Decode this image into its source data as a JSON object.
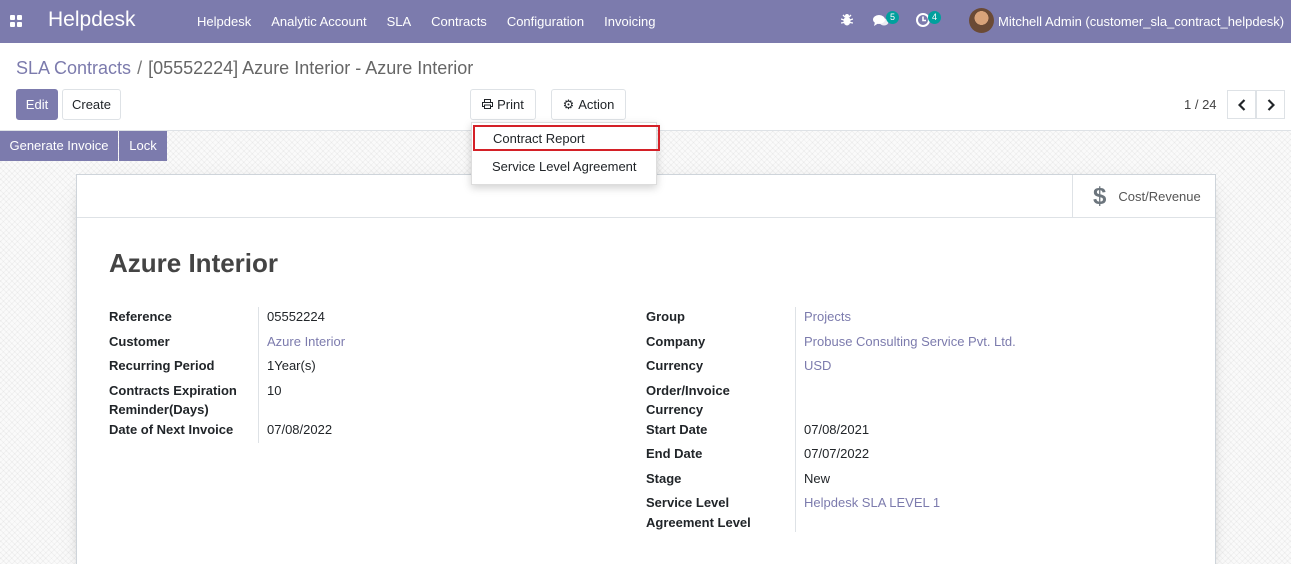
{
  "navbar": {
    "brand": "Helpdesk",
    "menu": [
      "Helpdesk",
      "Analytic Account",
      "SLA",
      "Contracts",
      "Configuration",
      "Invoicing"
    ],
    "messages_count": "5",
    "activities_count": "4",
    "user": "Mitchell Admin (customer_sla_contract_helpdesk)"
  },
  "breadcrumb": {
    "parent": "SLA Contracts",
    "separator": "/",
    "current": "[05552224] Azure Interior - Azure Interior"
  },
  "buttons": {
    "edit": "Edit",
    "create": "Create",
    "print": "Print",
    "action": "Action",
    "generate_invoice": "Generate Invoice",
    "lock": "Lock"
  },
  "pager": {
    "value": "1 / 24"
  },
  "print_menu": [
    "Contract Report",
    "Service Level Agreement"
  ],
  "stat_button": {
    "label": "Cost/Revenue",
    "icon": "dollar-icon"
  },
  "record": {
    "title": "Azure Interior",
    "left": {
      "reference_label": "Reference",
      "reference": "05552224",
      "customer_label": "Customer",
      "customer": "Azure Interior",
      "recurring_label": "Recurring Period",
      "recurring": "1Year(s)",
      "expiration_label_1": "Contracts Expiration",
      "expiration_label_2": "Reminder(Days)",
      "expiration": "10",
      "next_invoice_label": "Date of Next Invoice",
      "next_invoice": "07/08/2022"
    },
    "right": {
      "group_label": "Group",
      "group": "Projects",
      "company_label": "Company",
      "company": "Probuse Consulting Service Pvt. Ltd.",
      "currency_label": "Currency",
      "currency": "USD",
      "order_currency_label_1": "Order/Invoice",
      "order_currency_label_2": "Currency",
      "order_currency": "",
      "start_label": "Start Date",
      "start": "07/08/2021",
      "end_label": "End Date",
      "end": "07/07/2022",
      "stage_label": "Stage",
      "stage": "New",
      "sla_label_1": "Service Level",
      "sla_label_2": "Agreement Level",
      "sla": "Helpdesk SLA LEVEL 1"
    }
  },
  "colors": {
    "brand": "#7c7bad",
    "badge": "#00a09d",
    "highlight": "#d42027"
  }
}
